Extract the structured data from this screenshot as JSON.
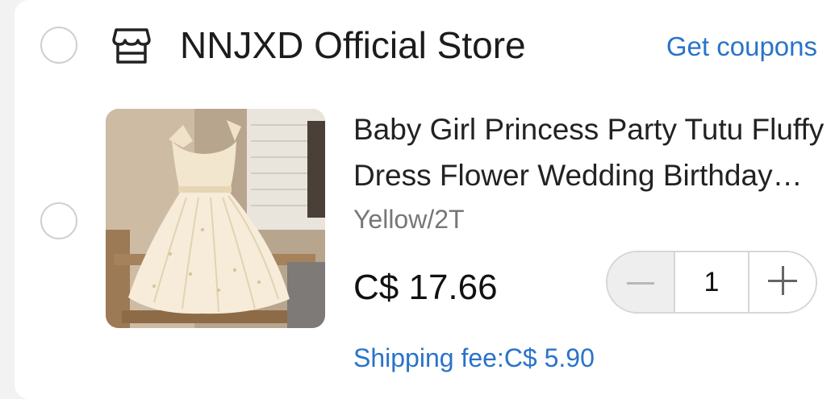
{
  "store": {
    "name": "NNJXD Official Store",
    "coupons_label": "Get coupons",
    "icon": "store-icon"
  },
  "item": {
    "title": "Baby Girl Princess Party Tutu Fluffy Dress Flower Wedding Birthday Dress",
    "variant": "Yellow/2T",
    "price": "C$ 17.66",
    "quantity": "1",
    "shipping": "Shipping fee:C$ 5.90"
  },
  "colors": {
    "accent_link": "#2a73c9",
    "text_primary": "#1c1c1c",
    "text_secondary": "#777777"
  }
}
